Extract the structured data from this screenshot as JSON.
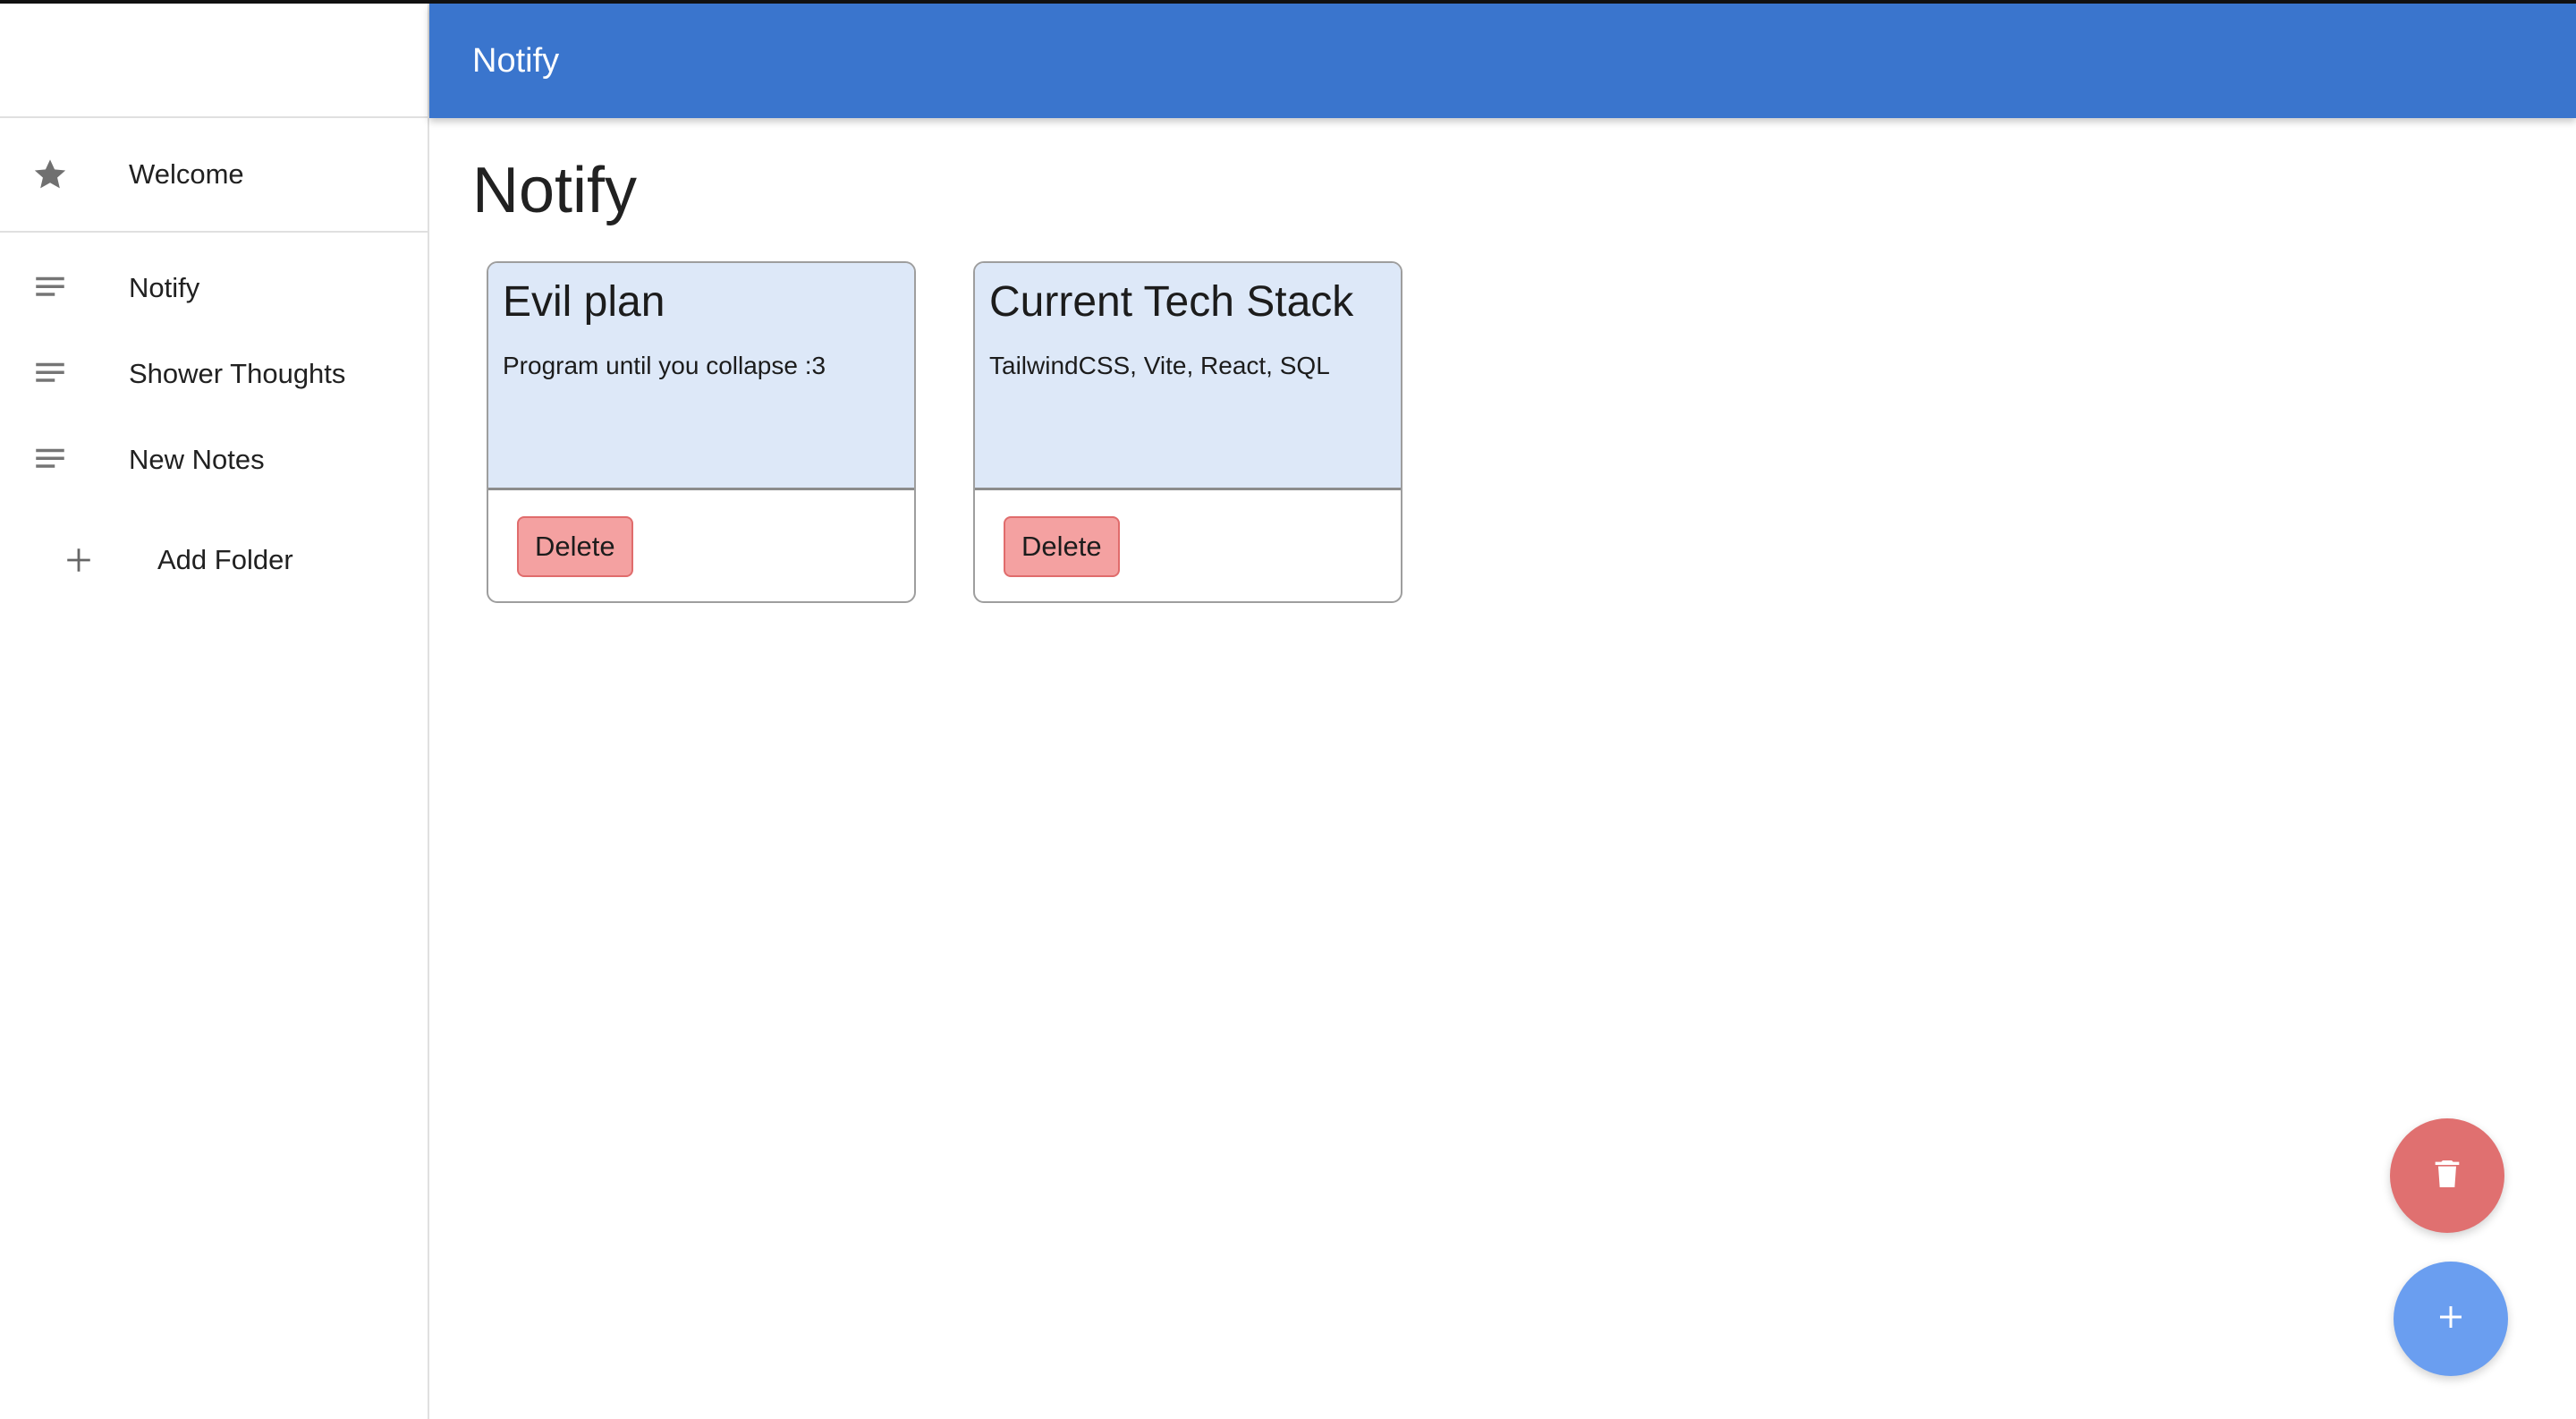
{
  "app": {
    "title": "Notify"
  },
  "colors": {
    "appbar": "#3a75cd",
    "card_body": "#dde8f8",
    "delete_button": "#f4a1a1",
    "fab_delete": "#e07070",
    "fab_add": "#6a9ef0"
  },
  "sidebar": {
    "welcome": {
      "label": "Welcome",
      "icon": "star-icon"
    },
    "items": [
      {
        "label": "Notify",
        "icon": "notes-icon"
      },
      {
        "label": "Shower Thoughts",
        "icon": "notes-icon"
      },
      {
        "label": "New Notes",
        "icon": "notes-icon"
      }
    ],
    "add_folder": {
      "label": "Add Folder",
      "icon": "plus-icon"
    }
  },
  "main": {
    "title": "Notify",
    "cards": [
      {
        "title": "Evil plan",
        "text": "Program until you collapse :3",
        "delete_label": "Delete"
      },
      {
        "title": "Current Tech Stack",
        "text": "TailwindCSS, Vite, React, SQL",
        "delete_label": "Delete"
      }
    ]
  },
  "fabs": {
    "delete_icon": "trash-icon",
    "add_icon": "plus-icon"
  }
}
